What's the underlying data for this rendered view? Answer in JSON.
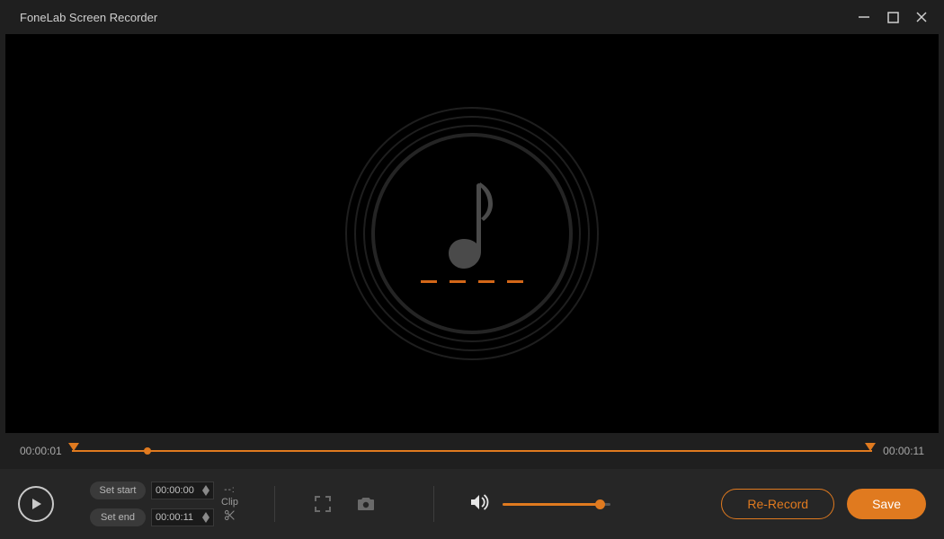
{
  "title": "FoneLab Screen Recorder",
  "timeline": {
    "current": "00:00:01",
    "total": "00:00:11",
    "playhead_pct": 9
  },
  "clip": {
    "set_start_label": "Set start",
    "set_end_label": "Set end",
    "start_value": "00:00:00",
    "end_value": "00:00:11",
    "clip_label": "Clip",
    "dash_placeholder": "--:"
  },
  "volume": {
    "level_pct": 90
  },
  "buttons": {
    "re_record": "Re-Record",
    "save": "Save"
  },
  "colors": {
    "accent": "#e07a1f",
    "bg_dark": "#1f1f1f",
    "bg_darker": "#000000",
    "bg_controlbar": "#262626"
  }
}
